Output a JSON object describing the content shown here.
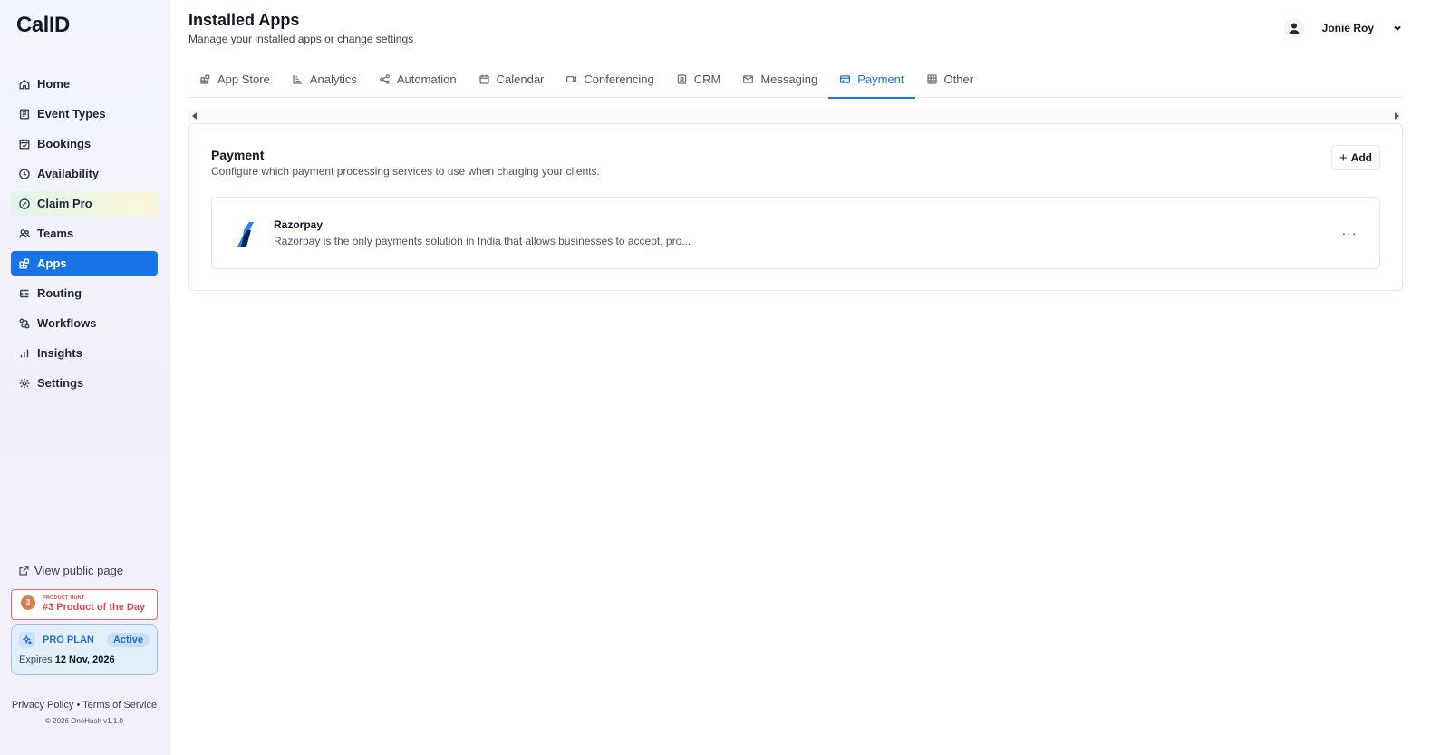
{
  "brand": {
    "logo": "CalID"
  },
  "sidebar": {
    "items": [
      {
        "label": "Home",
        "icon": "home-icon"
      },
      {
        "label": "Event Types",
        "icon": "event-types-icon"
      },
      {
        "label": "Bookings",
        "icon": "calendar-icon"
      },
      {
        "label": "Availability",
        "icon": "clock-icon"
      },
      {
        "label": "Claim Pro",
        "icon": "badge-icon"
      },
      {
        "label": "Teams",
        "icon": "users-icon"
      },
      {
        "label": "Apps",
        "icon": "apps-icon"
      },
      {
        "label": "Routing",
        "icon": "routing-icon"
      },
      {
        "label": "Workflows",
        "icon": "workflows-icon"
      },
      {
        "label": "Insights",
        "icon": "bar-chart-icon"
      },
      {
        "label": "Settings",
        "icon": "gear-icon"
      }
    ],
    "active": "Apps",
    "view_public_page": "View public page",
    "product_hunt": {
      "top": "PRODUCT HUNT",
      "main": "#3 Product of the Day",
      "rank": "3"
    },
    "plan": {
      "label": "PRO PLAN",
      "status": "Active",
      "expires_label": "Expires",
      "expires_date": "12 Nov, 2026"
    },
    "footer": {
      "privacy": "Privacy Policy",
      "separator": "•",
      "terms": "Terms of Service",
      "copyright": "© 2026 OneHash v1.1.0"
    }
  },
  "header": {
    "title": "Installed Apps",
    "subtitle": "Manage your installed apps or change settings",
    "user_name": "Jonie Roy"
  },
  "tabs": [
    {
      "label": "App Store",
      "icon": "app-store-icon"
    },
    {
      "label": "Analytics",
      "icon": "analytics-icon"
    },
    {
      "label": "Automation",
      "icon": "share-icon"
    },
    {
      "label": "Calendar",
      "icon": "calendar-icon"
    },
    {
      "label": "Conferencing",
      "icon": "video-icon"
    },
    {
      "label": "CRM",
      "icon": "contact-icon"
    },
    {
      "label": "Messaging",
      "icon": "mail-icon"
    },
    {
      "label": "Payment",
      "icon": "credit-card-icon"
    },
    {
      "label": "Other",
      "icon": "grid-icon"
    }
  ],
  "active_tab": "Payment",
  "payment": {
    "title": "Payment",
    "description": "Configure which payment processing services to use when charging your clients.",
    "add_label": "Add",
    "apps": [
      {
        "name": "Razorpay",
        "description": "Razorpay is the only payments solution in India that allows businesses to accept, pro...",
        "more_label": "···"
      }
    ]
  },
  "colors": {
    "accent": "#1774e6",
    "product_hunt": "#e0484a",
    "pro_plan": "#1f70d6"
  }
}
